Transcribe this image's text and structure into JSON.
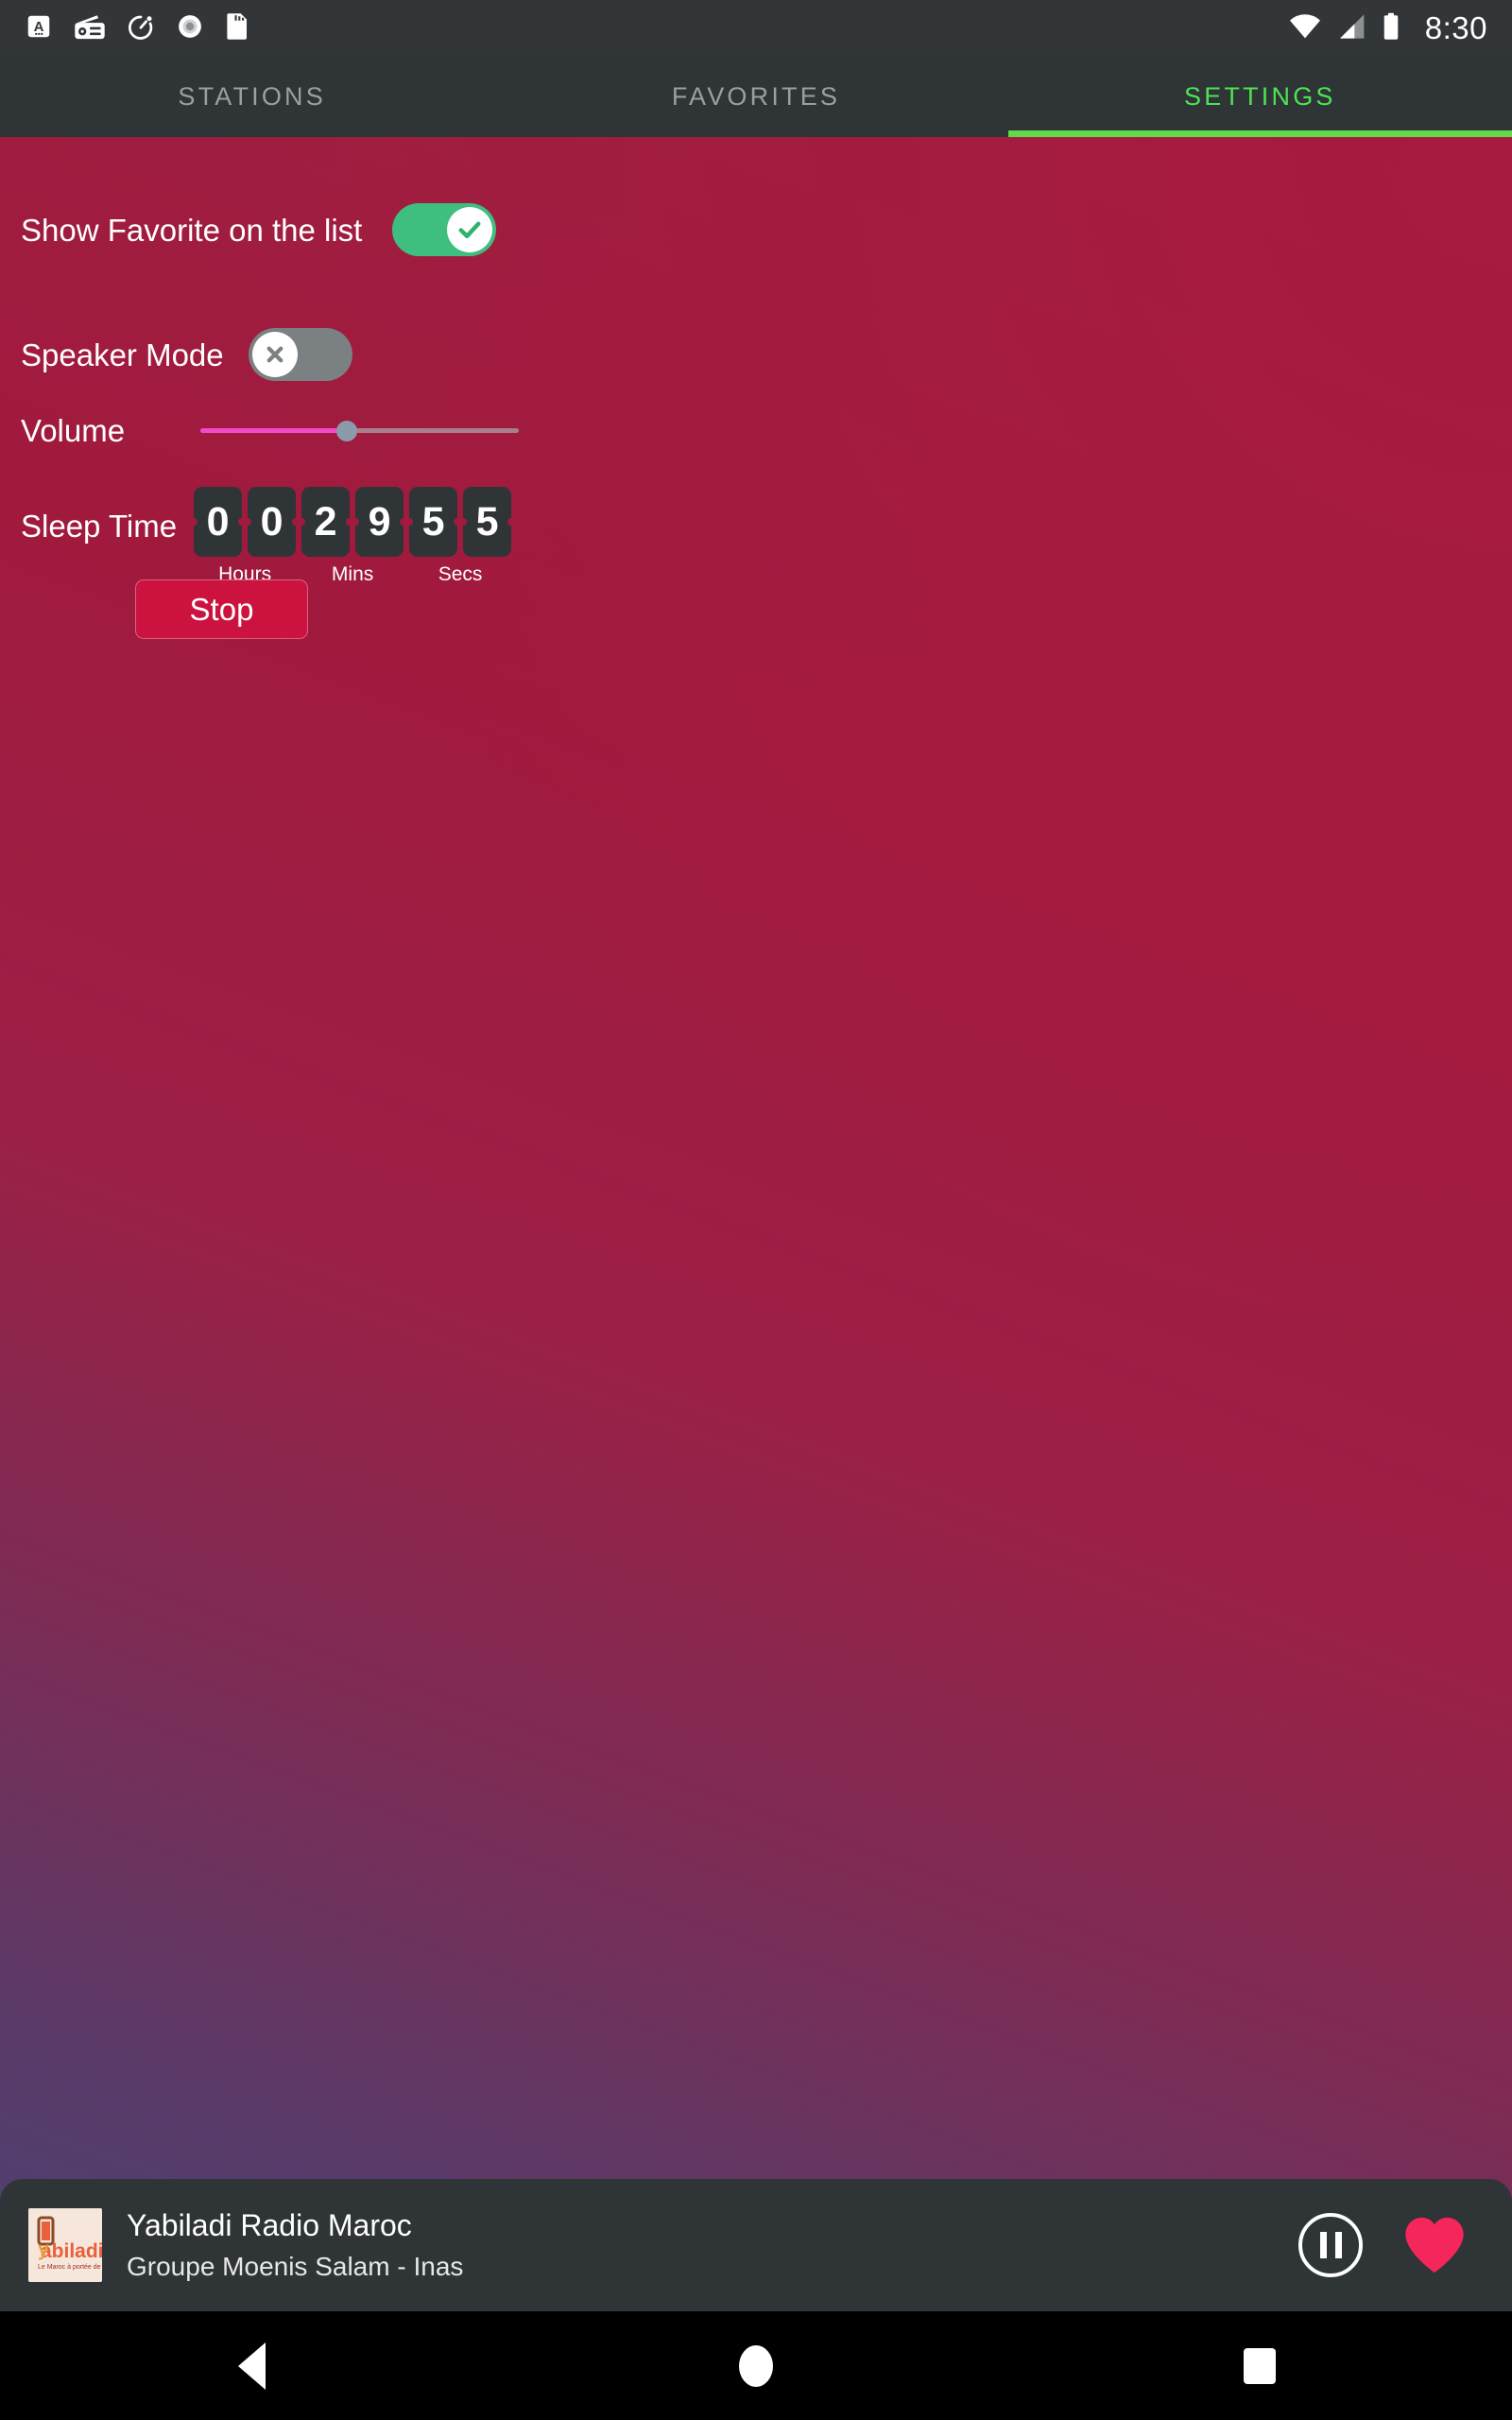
{
  "statusbar": {
    "icons": [
      "keyboard-indicator-icon",
      "radio-icon",
      "timer-icon",
      "record-circle-icon",
      "sd-card-icon"
    ],
    "wifi": "wifi-icon",
    "cellular": "cellular-signal-icon",
    "battery": "battery-full-icon",
    "clock": "8:30"
  },
  "tabs": [
    {
      "label": "STATIONS",
      "active": false
    },
    {
      "label": "FAVORITES",
      "active": false
    },
    {
      "label": "SETTINGS",
      "active": true
    }
  ],
  "settings": {
    "show_favorite": {
      "label": "Show Favorite on the list",
      "state": "on",
      "knob_glyph": "✓"
    },
    "speaker_mode": {
      "label": "Speaker Mode",
      "state": "off",
      "knob_glyph": "✕"
    },
    "volume": {
      "label": "Volume",
      "percent": 46
    },
    "sleep_time": {
      "label": "Sleep Time",
      "groups": [
        {
          "unit": "Hours",
          "digits": [
            "0",
            "0"
          ]
        },
        {
          "unit": "Mins",
          "digits": [
            "2",
            "9"
          ]
        },
        {
          "unit": "Secs",
          "digits": [
            "5",
            "5"
          ]
        }
      ]
    },
    "stop_button": "Stop"
  },
  "player": {
    "album_art_text": "Yabiladi",
    "album_art_tagline": "Le Maroc à portée de clic !",
    "station": "Yabiladi Radio Maroc",
    "track": "Groupe Moenis Salam - Inas",
    "pause_icon": "pause-icon",
    "favorite_icon": "heart-filled-icon"
  },
  "navbar": {
    "back": "back-triangle-icon",
    "home": "home-circle-icon",
    "recents": "recents-square-icon"
  },
  "colors": {
    "accent_green": "#62d94a",
    "toggle_on": "#3fbf7f",
    "toggle_off": "#7b8083",
    "slider_fill": "#f34bc8",
    "stop_button": "#cc123f",
    "heart": "#f5265c",
    "bar_dark": "#2f3437"
  }
}
